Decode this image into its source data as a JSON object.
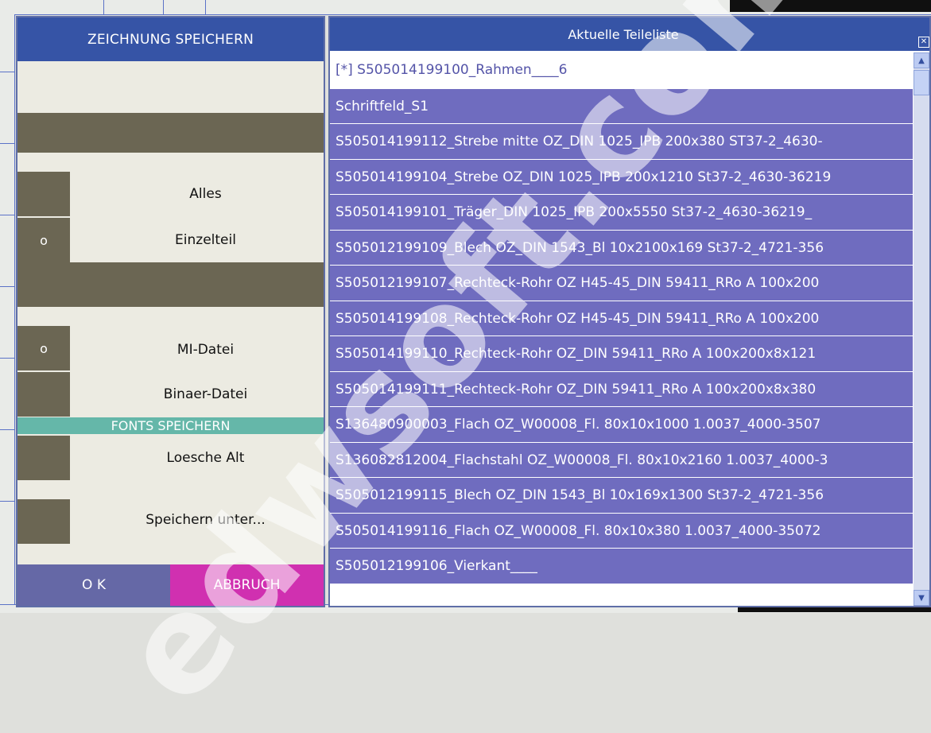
{
  "left_dialog": {
    "title": "ZEICHNUNG SPEICHERN",
    "options": {
      "alles": {
        "label": "Alles",
        "marker": ""
      },
      "einzelteil": {
        "label": "Einzelteil",
        "marker": "o"
      },
      "mi_datei": {
        "label": "MI-Datei",
        "marker": "o"
      },
      "binaer_datei": {
        "label": "Binaer-Datei",
        "marker": ""
      },
      "loesche_alt": {
        "label": "Loesche Alt",
        "marker": ""
      },
      "speichern_unter": {
        "label": "Speichern unter...",
        "marker": ""
      }
    },
    "fonts_section": "FONTS SPEICHERN",
    "ok_label": "O K",
    "cancel_label": "ABBRUCH"
  },
  "right_dialog": {
    "title": "Aktuelle Teileliste",
    "items": [
      "[*] S505014199100_Rahmen____6",
      "Schriftfeld_S1",
      "S505014199112_Strebe mitte OZ_DIN 1025_IPB 200x380 ST37-2_4630-",
      "S505014199104_Strebe OZ_DIN 1025_IPB 200x1210 St37-2_4630-36219",
      "S505014199101_Träger_DIN 1025_IPB 200x5550 St37-2_4630-36219_",
      "S505012199109_Blech OZ_DIN 1543_Bl 10x2100x169 St37-2_4721-356",
      "S505012199107_Rechteck-Rohr OZ H45-45_DIN 59411_RRo A 100x200",
      "S505014199108_Rechteck-Rohr OZ H45-45_DIN 59411_RRo A 100x200",
      "S505014199110_Rechteck-Rohr OZ_DIN 59411_RRo A 100x200x8x121",
      "S505014199111_Rechteck-Rohr OZ_DIN 59411_RRo A 100x200x8x380",
      "S136480900003_Flach OZ_W00008_Fl. 80x10x1000 1.0037_4000-3507",
      "S136082812004_Flachstahl OZ_W00008_Fl. 80x10x2160 1.0037_4000-3",
      "S505012199115_Blech OZ_DIN 1543_Bl 10x169x1300 St37-2_4721-356",
      "S505014199116_Flach OZ_W00008_Fl. 80x10x380 1.0037_4000-35072",
      "S505012199106_Vierkant____"
    ],
    "close_icon": "close-box-icon"
  },
  "watermark": "edwsoft.com",
  "colors": {
    "title_blue": "#3654a6",
    "list_purple": "#6f6cbf",
    "olive": "#6b6653",
    "teal": "#65b7a9",
    "magenta": "#d030b0"
  }
}
